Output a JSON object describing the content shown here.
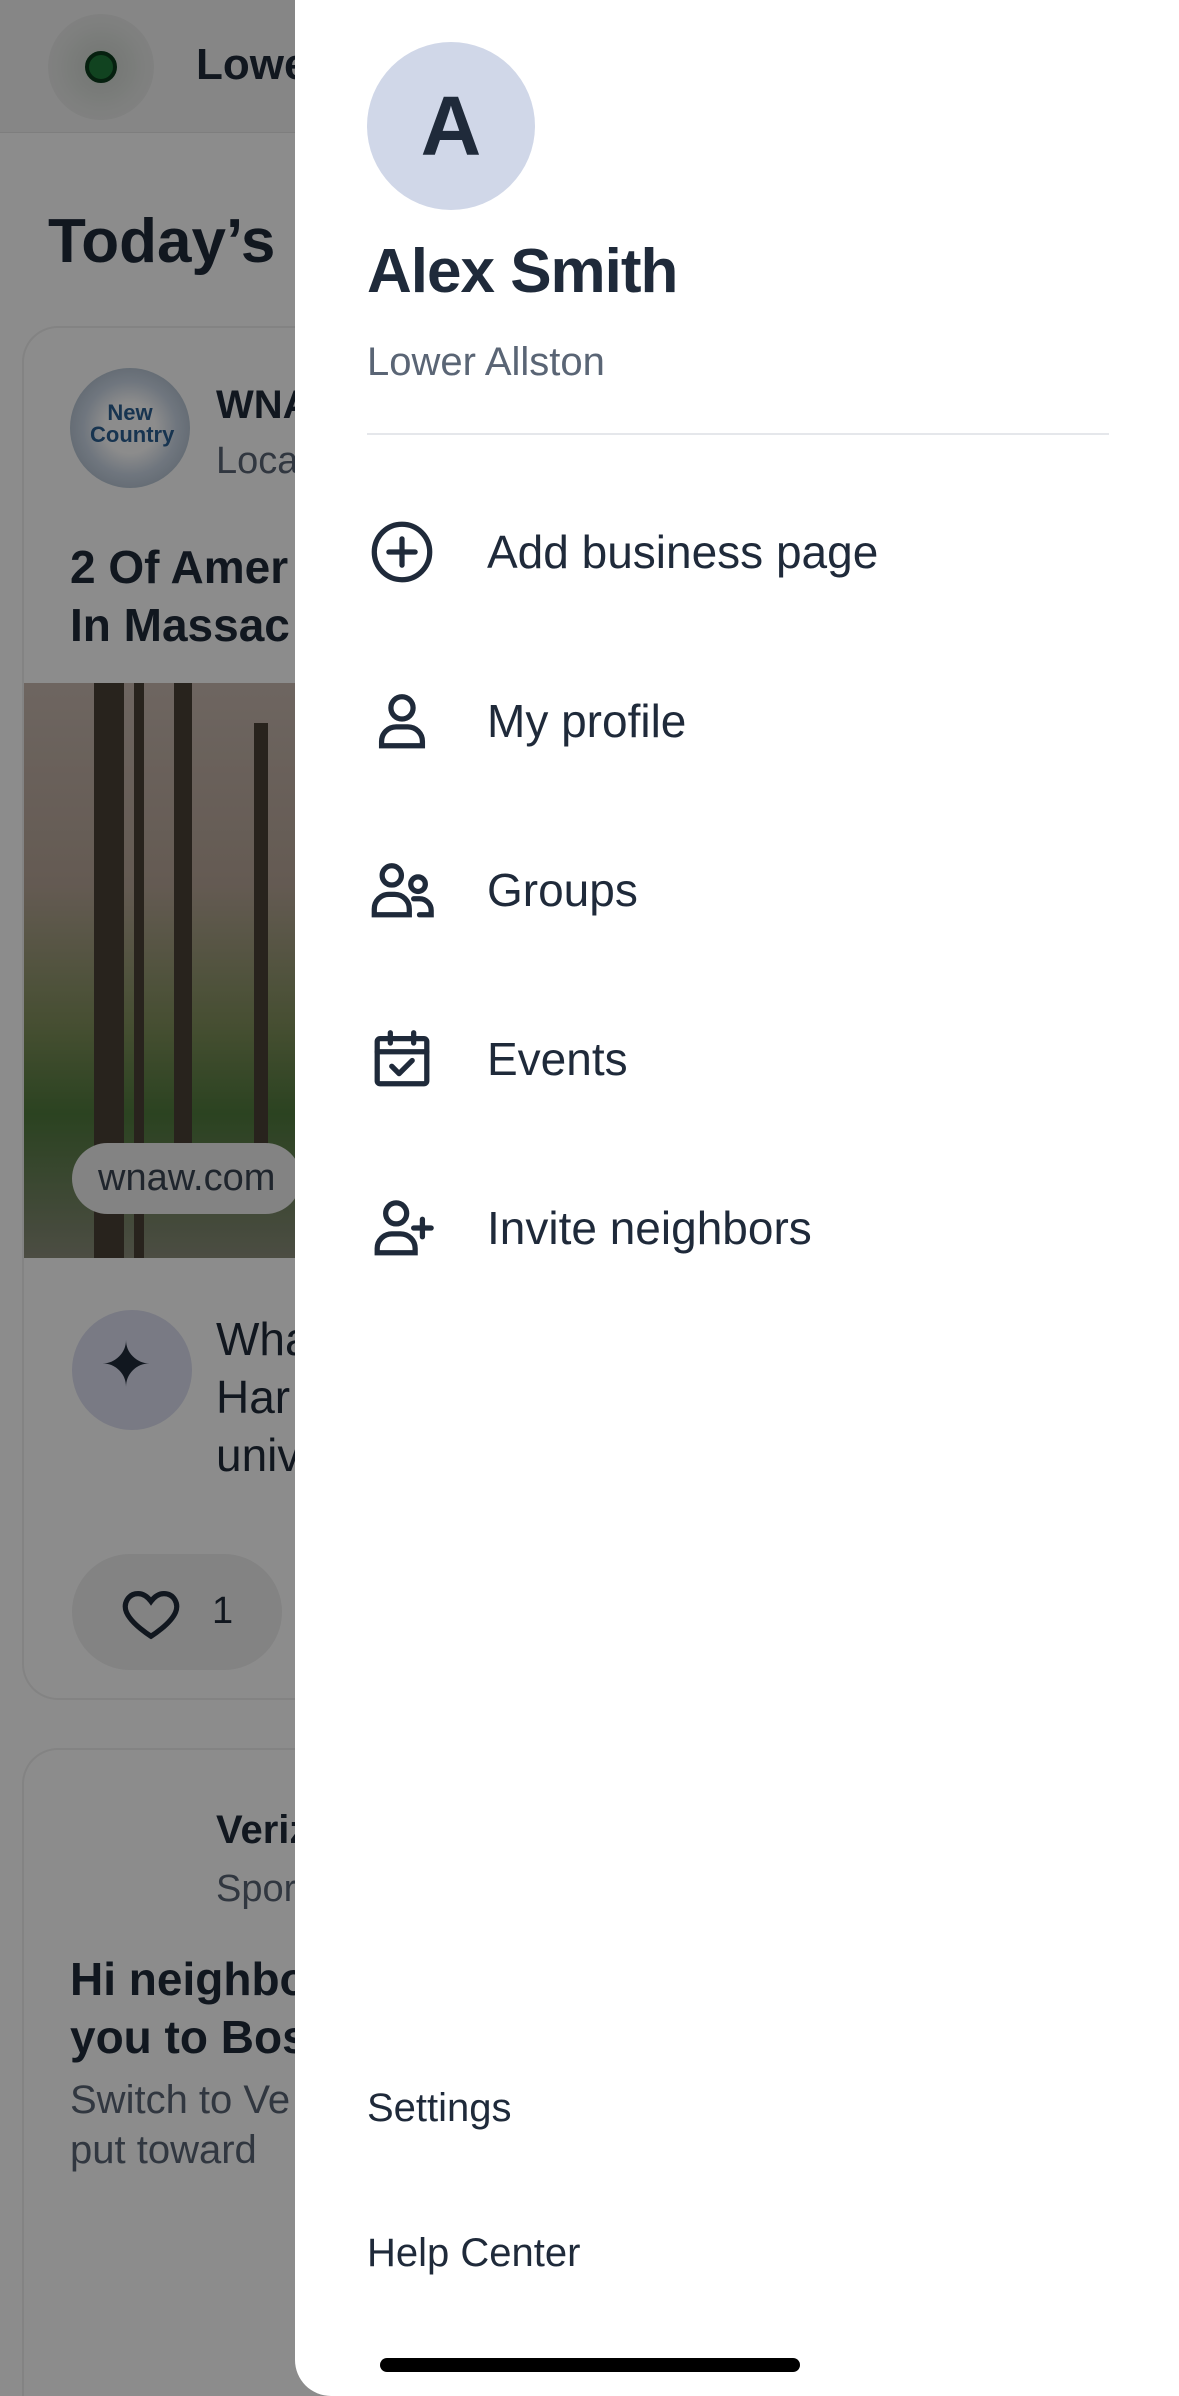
{
  "background_feed": {
    "location_title": "Lowe",
    "heading": "Today’s l",
    "post": {
      "author": "WNA",
      "subtitle": "Loca",
      "headline_line1": "2 Of Amer",
      "headline_line2": "In Massac",
      "source": "wnaw.com",
      "logo_text": "New Country",
      "ai_text_line1": "Wha",
      "ai_text_line2": "Har",
      "ai_text_line3": "univ",
      "like_count": "1"
    },
    "sponsored": {
      "author": "Veriz",
      "subtitle": "Spor",
      "headline_line1": "Hi neighbo",
      "headline_line2": "you to Bos",
      "body_line1": "Switch to Ve",
      "body_line2": "put toward"
    }
  },
  "drawer": {
    "avatar_letter": "A",
    "user_name": "Alex Smith",
    "user_location": "Lower Allston",
    "menu": [
      {
        "label": "Add business page",
        "icon": "plus-circle-icon"
      },
      {
        "label": "My profile",
        "icon": "person-icon"
      },
      {
        "label": "Groups",
        "icon": "groups-icon"
      },
      {
        "label": "Events",
        "icon": "calendar-check-icon"
      },
      {
        "label": "Invite neighbors",
        "icon": "person-add-icon"
      }
    ],
    "footer": {
      "settings_label": "Settings",
      "help_label": "Help Center"
    }
  },
  "colors": {
    "text_primary": "#1f2a3a",
    "text_secondary": "#5a6575",
    "avatar_bg": "#d0d7e8",
    "scrim": "rgba(0,0,0,0.45)"
  }
}
